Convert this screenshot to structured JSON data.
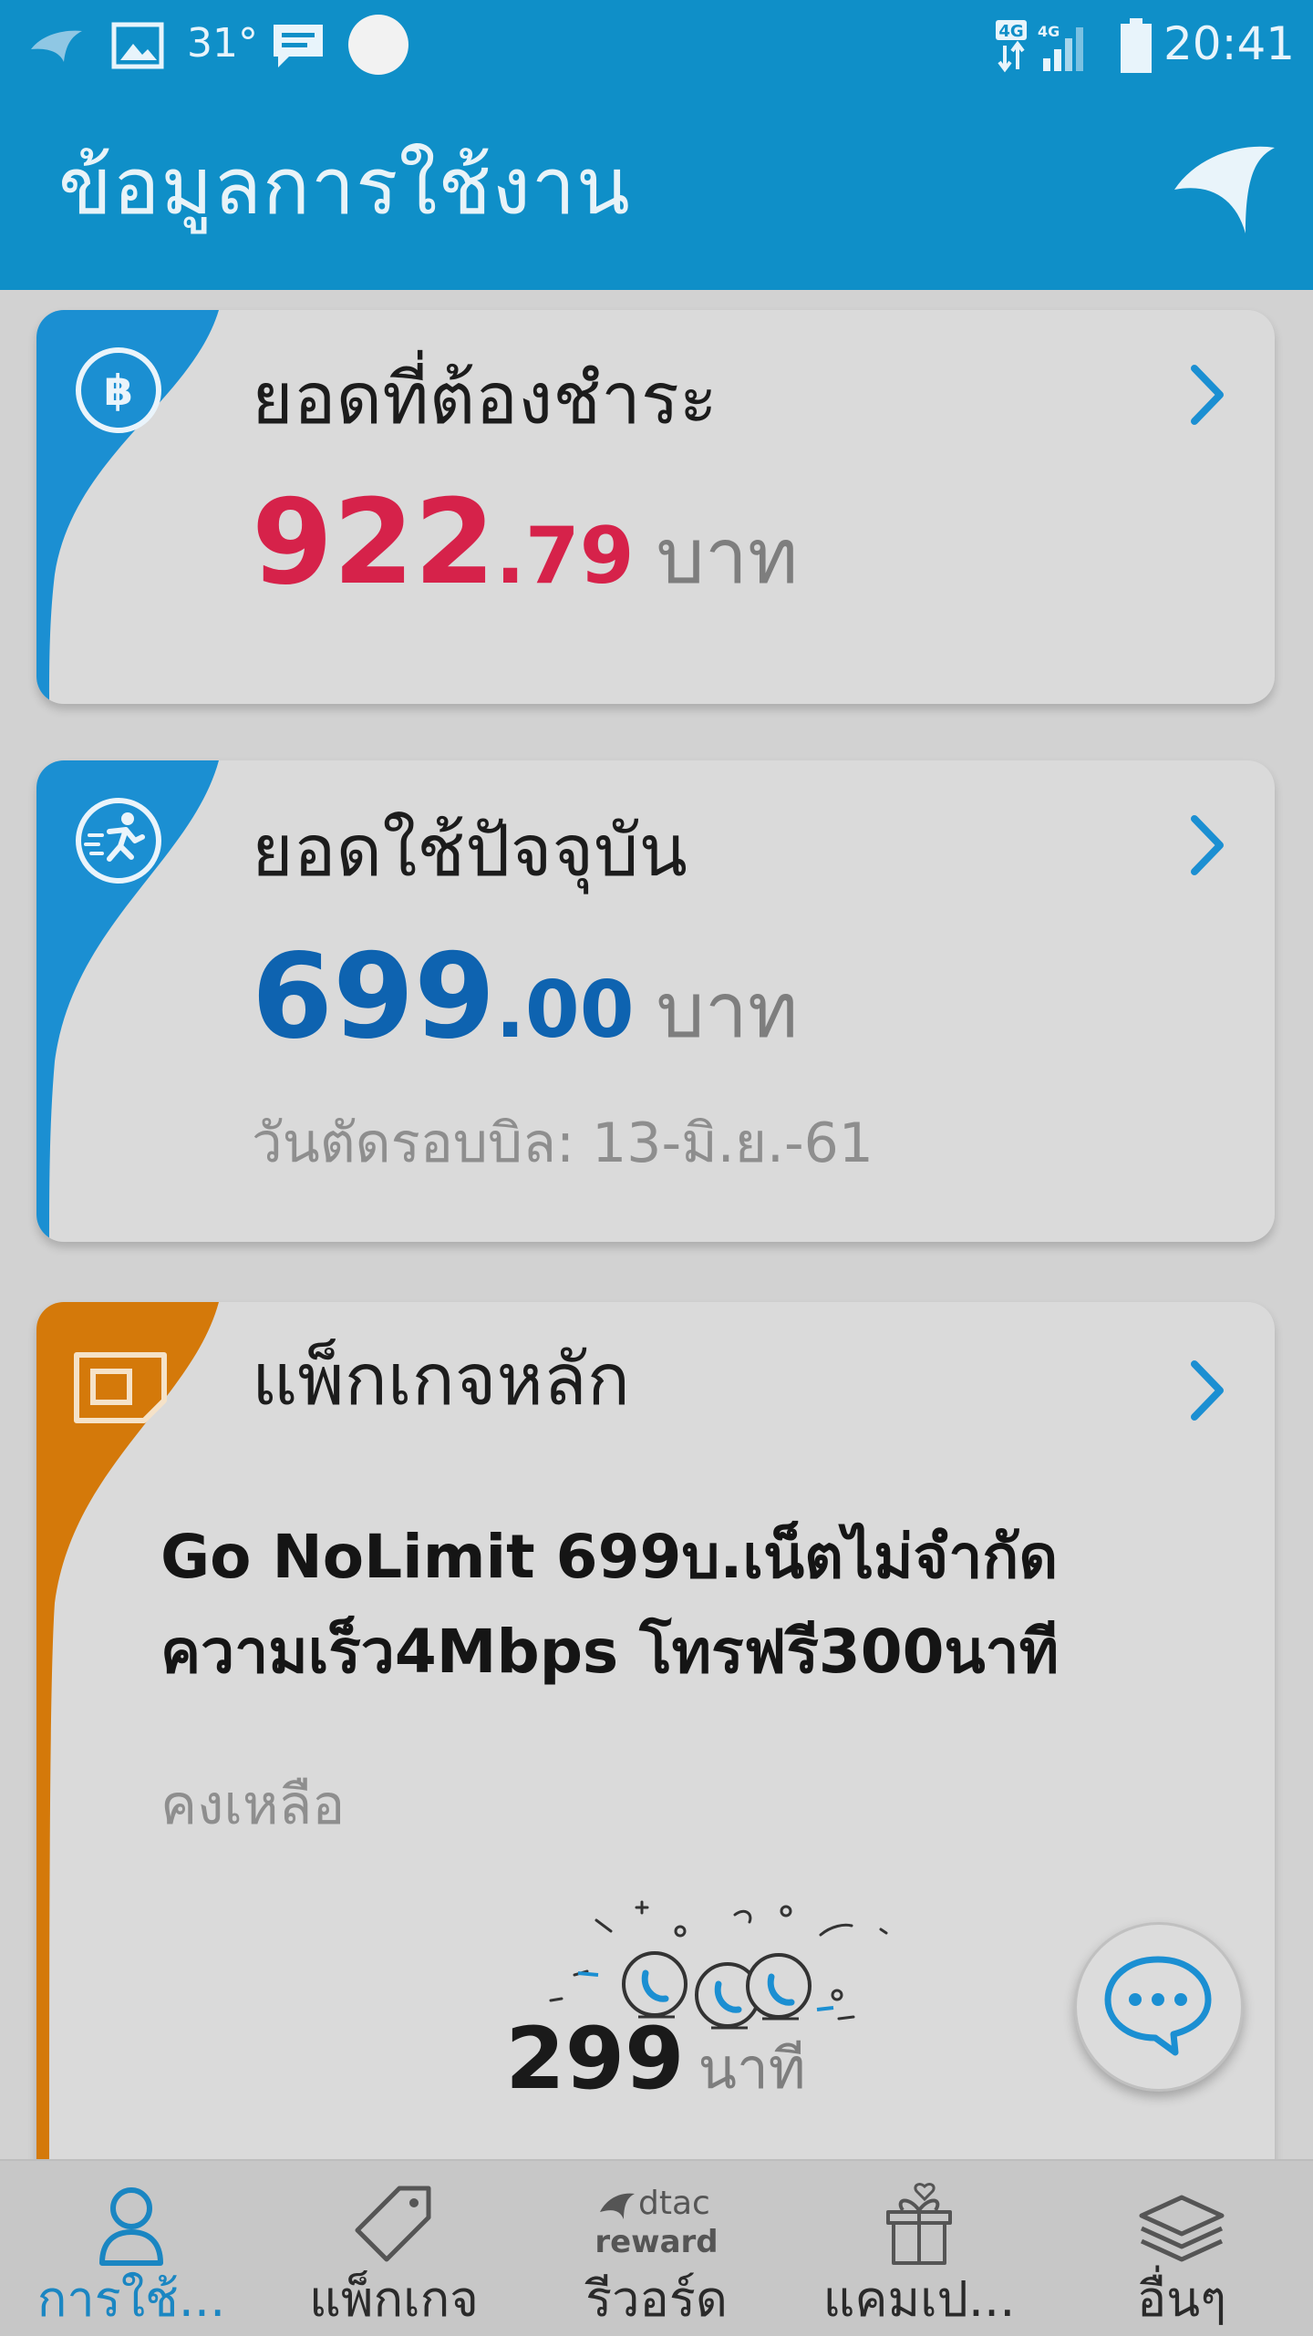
{
  "status_bar": {
    "temperature": "31°",
    "time": "20:41",
    "network_label_1": "4G",
    "network_label_2": "4G"
  },
  "app_bar": {
    "title": "ข้อมูลการใช้งาน"
  },
  "cards": {
    "balance_due": {
      "title": "ยอดที่ต้องชำระ",
      "amount_main": "922",
      "amount_dec": ".79",
      "unit": "บาท",
      "amount_color": "#d6224a"
    },
    "current_usage": {
      "title": "ยอดใช้ปัจจุบัน",
      "amount_main": "699",
      "amount_dec": ".00",
      "unit": "บาท",
      "amount_color": "#0e63b0",
      "cycle_label": "วันตัดรอบบิล: 13-มิ.ย.-61"
    },
    "main_package": {
      "title": "แพ็กเกจหลัก",
      "package_line_1": "Go NoLimit 699บ.เน็ตไม่จำกัด",
      "package_line_2": "ความเร็ว4Mbps โทรฟรี300นาที",
      "remaining_label": "คงเหลือ",
      "remaining_value": "299",
      "remaining_unit": "นาที",
      "accent_color": "#d4790a"
    }
  },
  "accent_blue": "#1b8fd2",
  "bottom_nav": {
    "items": [
      {
        "label": "การใช้...",
        "icon": "person-icon"
      },
      {
        "label": "แพ็กเกจ",
        "icon": "tag-icon"
      },
      {
        "label": "รีวอร์ด",
        "icon": "dtac-reward-icon",
        "brand_text_1": "dtac",
        "brand_text_2": "reward"
      },
      {
        "label": "แคมเป...",
        "icon": "gift-box-icon"
      },
      {
        "label": "อื่นๆ",
        "icon": "layers-icon"
      }
    ]
  }
}
